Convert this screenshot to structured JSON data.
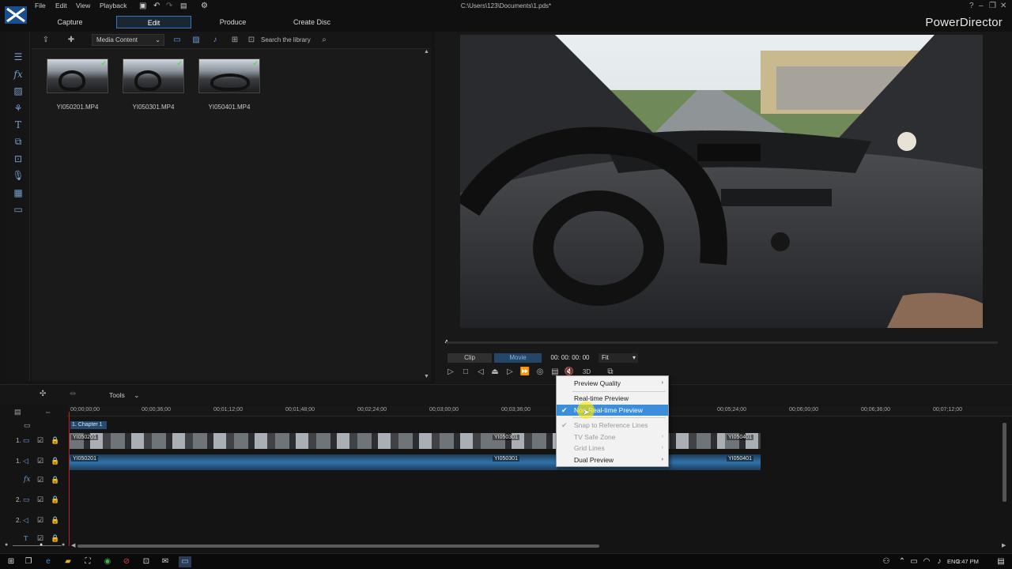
{
  "window": {
    "title": "C:\\Users\\123\\Documents\\1.pds*",
    "brand": "PowerDirector",
    "help": "?"
  },
  "menu": [
    "File",
    "Edit",
    "View",
    "Playback"
  ],
  "modes": [
    "Capture",
    "Edit",
    "Produce",
    "Create Disc"
  ],
  "library": {
    "dropdown": "Media Content",
    "search_placeholder": "Search the library",
    "items": [
      "YI050201.MP4",
      "YI050301.MP4",
      "YI050401.MP4"
    ]
  },
  "preview": {
    "clip_label": "Clip",
    "movie_label": "Movie",
    "timecode": "00: 00: 00: 00",
    "fit": "Fit",
    "threed": "3D"
  },
  "timeline": {
    "tools_label": "Tools",
    "ruler": [
      "00;00;00;00",
      "00;00;36;00",
      "00;01;12;00",
      "00;01;48;00",
      "00;02;24;00",
      "00;03;00;00",
      "00;03;36;00",
      "00;05;24;00",
      "00;06;00;00",
      "00;06;36;00",
      "00;07;12;00"
    ],
    "chapter": "1. Chapter 1",
    "clips": [
      "YI050201",
      "YI050301",
      "YI050401"
    ],
    "track_labels": [
      "1.",
      "1.",
      "2.",
      "2."
    ]
  },
  "context_menu": {
    "items": [
      {
        "label": "Preview Quality",
        "submenu": true,
        "disabled": false
      },
      {
        "label": "Real-time Preview",
        "submenu": false,
        "disabled": false
      },
      {
        "label": "Non Real-time Preview",
        "submenu": false,
        "disabled": false,
        "checked": true,
        "selected": true
      },
      {
        "label": "Snap to Reference Lines",
        "submenu": false,
        "disabled": true
      },
      {
        "label": "TV Safe Zone",
        "submenu": true,
        "disabled": true
      },
      {
        "label": "Grid Lines",
        "submenu": true,
        "disabled": true
      },
      {
        "label": "Dual Preview",
        "submenu": true,
        "disabled": false
      }
    ]
  },
  "taskbar": {
    "lang": "ENG",
    "time": "2:47 PM"
  }
}
